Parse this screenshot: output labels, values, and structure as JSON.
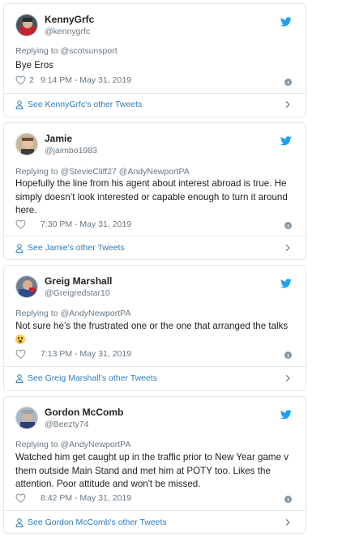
{
  "tweets": [
    {
      "display_name": "KennyGrfc",
      "handle": "@kennygrfc",
      "replying_prefix": "Replying to ",
      "replying_to": "@scotsunsport",
      "text": "Bye Eros",
      "likes": "2",
      "time": "9:14 PM - May 31, 2019",
      "footer": "See KennyGrfc's other Tweets"
    },
    {
      "display_name": "Jamie",
      "handle": "@jaimbo1983",
      "replying_prefix": "Replying to ",
      "replying_to": "@StevieCliff27 @AndyNewportPA",
      "text": "Hopefully the line from his agent about interest abroad is true. He simply doesn’t look interested or capable enough to turn it around here.",
      "likes": "",
      "time": "7:30 PM - May 31, 2019",
      "footer": "See Jamie's other Tweets"
    },
    {
      "display_name": "Greig Marshall",
      "handle": "@Greigredstar10",
      "replying_prefix": "Replying to ",
      "replying_to": "@AndyNewportPA",
      "text": "Not sure he’s the frustrated one or the one that arranged the talks",
      "likes": "",
      "time": "7:13 PM - May 31, 2019",
      "footer": "See Greig Marshall's other Tweets"
    },
    {
      "display_name": "Gordon McComb",
      "handle": "@Beezty74",
      "replying_prefix": "Replying to ",
      "replying_to": "@AndyNewportPA",
      "text": "Watched him get caught up in the traffic prior to New  Year game v them outside Main Stand and met him at POTY too. Likes the attention. Poor attitude and won't be missed.",
      "likes": "",
      "time": "8:42 PM - May 31, 2019",
      "footer": "See Gordon McComb's other Tweets"
    }
  ],
  "icons": {
    "bird": "twitter-bird-icon",
    "heart": "heart-icon",
    "info": "info-icon",
    "person": "person-icon",
    "chevron": "chevron-right-icon",
    "emoji": "flushed-face-emoji"
  },
  "colors": {
    "twitter_blue": "#1da1f2",
    "link_blue": "#2b7bb9",
    "meta_gray": "#697882",
    "border": "#e1e8ed"
  }
}
